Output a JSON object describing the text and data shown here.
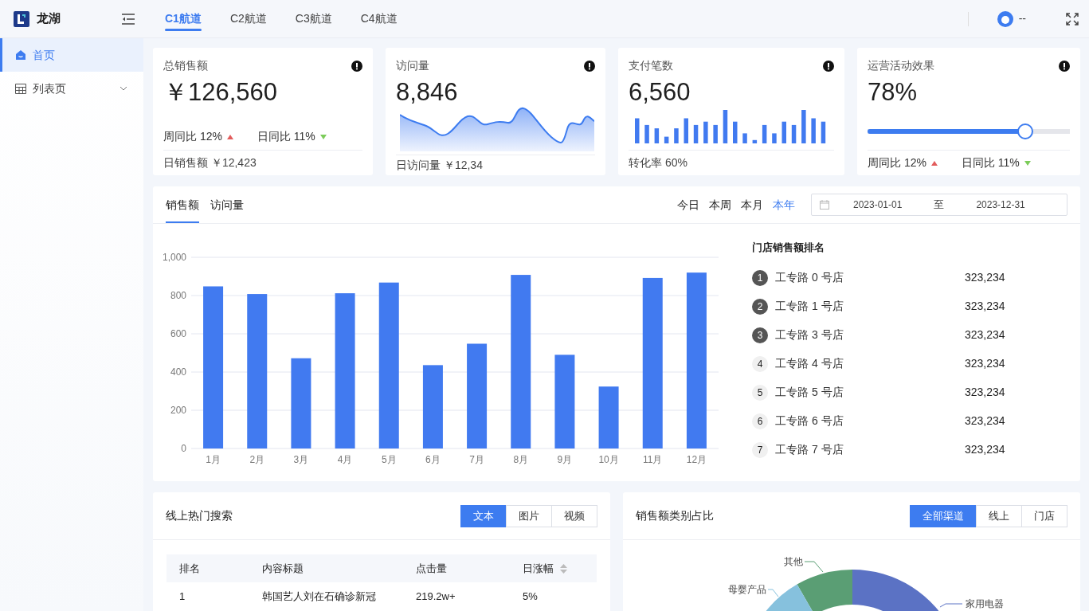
{
  "brand": {
    "name": "龙湖"
  },
  "top_nav": [
    {
      "label": "C1航道",
      "selected": true
    },
    {
      "label": "C2航道",
      "selected": false
    },
    {
      "label": "C3航道",
      "selected": false
    },
    {
      "label": "C4航道",
      "selected": false
    }
  ],
  "user": {
    "name": "--"
  },
  "sidebar": {
    "items": [
      {
        "label": "首页",
        "selected": true,
        "kind": "link"
      },
      {
        "label": "列表页",
        "selected": false,
        "kind": "group",
        "expanded": false
      }
    ]
  },
  "stat_cards": [
    {
      "title": "总销售额",
      "value": "￥126,560",
      "kind": "trends",
      "trends": [
        {
          "label": "周同比 12%",
          "up": true
        },
        {
          "label": "日同比 11%",
          "up": false
        }
      ],
      "footer": "日销售额 ￥12,423"
    },
    {
      "title": "访问量",
      "value": "8,846",
      "kind": "area",
      "footer": "日访问量 ￥12,34"
    },
    {
      "title": "支付笔数",
      "value": "6,560",
      "kind": "bars",
      "footer": "转化率 60%"
    },
    {
      "title": "运营活动效果",
      "value": "78%",
      "kind": "progress",
      "level": 0.78,
      "trends": [
        {
          "label": "周同比 12%",
          "up": true
        },
        {
          "label": "日同比 11%",
          "up": false
        }
      ]
    }
  ],
  "sales_panel": {
    "tabs": [
      {
        "label": "销售额",
        "selected": true
      },
      {
        "label": "访问量",
        "selected": false
      }
    ],
    "ranges": [
      {
        "label": "今日",
        "selected": false
      },
      {
        "label": "本周",
        "selected": false
      },
      {
        "label": "本月",
        "selected": false
      },
      {
        "label": "本年",
        "selected": true
      }
    ],
    "date_range": {
      "start": "2023-01-01",
      "separator": "至",
      "end": "2023-12-31"
    },
    "chart_data": {
      "type": "bar",
      "categories": [
        "1月",
        "2月",
        "3月",
        "4月",
        "5月",
        "6月",
        "7月",
        "8月",
        "9月",
        "10月",
        "11月",
        "12月"
      ],
      "grid": true,
      "series": [
        {
          "color": "#417af0",
          "values": [
            848,
            808,
            472,
            812,
            868,
            436,
            548,
            908,
            490,
            324,
            892,
            920
          ]
        }
      ],
      "ylim": [
        0,
        1000
      ],
      "yticks": [
        0,
        200,
        400,
        600,
        800,
        {
          "value": 1000,
          "label": "1,000"
        }
      ]
    },
    "ranking": {
      "title": "门店销售额排名",
      "items": [
        {
          "rank": "1",
          "name": "工专路 0 号店",
          "value": "323,234",
          "highlighted": true
        },
        {
          "rank": "2",
          "name": "工专路 1 号店",
          "value": "323,234",
          "highlighted": true
        },
        {
          "rank": "3",
          "name": "工专路 3 号店",
          "value": "323,234",
          "highlighted": true
        },
        {
          "rank": "4",
          "name": "工专路 4 号店",
          "value": "323,234",
          "highlighted": false
        },
        {
          "rank": "5",
          "name": "工专路 5 号店",
          "value": "323,234",
          "highlighted": false
        },
        {
          "rank": "6",
          "name": "工专路 6 号店",
          "value": "323,234",
          "highlighted": false
        },
        {
          "rank": "7",
          "name": "工专路 7 号店",
          "value": "323,234",
          "highlighted": false
        }
      ]
    }
  },
  "hot_search": {
    "title": "线上热门搜索",
    "filters": [
      {
        "label": "文本",
        "selected": true
      },
      {
        "label": "图片",
        "selected": false
      },
      {
        "label": "视频",
        "selected": false
      }
    ],
    "table": {
      "columns": [
        {
          "label": "排名",
          "sortable": false
        },
        {
          "label": "内容标题",
          "sortable": false
        },
        {
          "label": "点击量",
          "sortable": false
        },
        {
          "label": "日涨幅",
          "sortable": true
        }
      ],
      "rows": [
        [
          "1",
          "韩国艺人刘在石确诊新冠",
          "219.2w+",
          "5%"
        ]
      ]
    }
  },
  "category_share": {
    "title": "销售额类别占比",
    "filters": [
      {
        "label": "全部渠道",
        "selected": true
      },
      {
        "label": "线上",
        "selected": false
      },
      {
        "label": "门店",
        "selected": false
      }
    ],
    "donut_labels": [
      {
        "label": "其他",
        "color": "#5a9e74"
      },
      {
        "label": "母婴产品",
        "color": "#86c1dd"
      },
      {
        "label": "家用电器",
        "color": "#5b72c4"
      }
    ]
  }
}
